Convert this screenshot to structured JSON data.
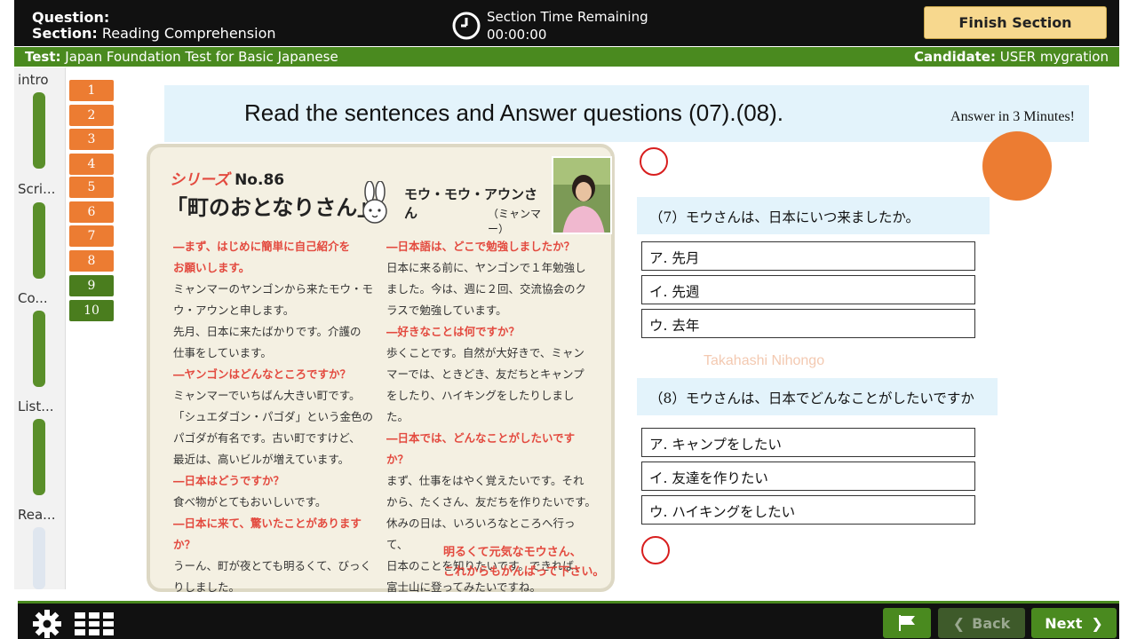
{
  "header": {
    "question_label": "Question:",
    "section_label": "Section:",
    "section_value": "Reading Comprehension",
    "timer_title": "Section Time Remaining",
    "timer_value": "00:00:00",
    "finish_button": "Finish Section"
  },
  "testbar": {
    "test_label": "Test:",
    "test_value": "Japan Foundation Test for Basic Japanese",
    "candidate_label": "Candidate",
    "candidate_value": "USER mygration"
  },
  "sidebar": {
    "items": [
      {
        "label": "intro"
      },
      {
        "label": "Scri..."
      },
      {
        "label": "Co..."
      },
      {
        "label": "List..."
      },
      {
        "label": "Rea..."
      }
    ]
  },
  "question_numbers": [
    "1",
    "2",
    "3",
    "4",
    "5",
    "6",
    "7",
    "8",
    "9",
    "10"
  ],
  "instructions": {
    "text": "Read the sentences and Answer questions (07).(08).",
    "time_note": "Answer in 3 Minutes!"
  },
  "article": {
    "series": "シリーズ",
    "series_no": "No.86",
    "title": "「町のおとなりさん」",
    "name": "モウ・モウ・アウンさん",
    "country": "（ミャンマー）",
    "left_col": [
      {
        "q": "―まず、はじめに簡単に自己紹介を"
      },
      {
        "q": "お願いします。"
      },
      {
        "t": "ミャンマーのヤンゴンから来たモウ・モ"
      },
      {
        "t": "ウ・アウンと申します。"
      },
      {
        "t": "先月、日本に来たばかりです。介護の"
      },
      {
        "t": "仕事をしています。"
      },
      {
        "q": "―ヤンゴンはどんなところですか？"
      },
      {
        "t": "ミャンマーでいちばん大きい町です。"
      },
      {
        "t": "「シュエダゴン・パゴダ」という金色の"
      },
      {
        "t": "パゴダが有名です。古い町ですけど、"
      },
      {
        "t": "最近は、高いビルが増えています。"
      },
      {
        "q": "―日本はどうですか？"
      },
      {
        "t": "食べ物がとてもおいしいです。"
      },
      {
        "q": "―日本に来て、驚いたことがありますか？"
      },
      {
        "t": "うーん、町が夜とても明るくて、びっく"
      },
      {
        "t": "りしました。"
      }
    ],
    "right_col": [
      {
        "q": "―日本語は、どこで勉強しましたか？"
      },
      {
        "t": "日本に来る前に、ヤンゴンで１年勉強し"
      },
      {
        "t": "ました。今は、週に２回、交流協会のク"
      },
      {
        "t": "ラスで勉強しています。"
      },
      {
        "q": "―好きなことは何ですか？"
      },
      {
        "t": "歩くことです。自然が大好きで、ミャン"
      },
      {
        "t": "マーでは、ときどき、友だちとキャンプ"
      },
      {
        "t": "をしたり、ハイキングをしたりしました。"
      },
      {
        "q": "―日本では、どんなことがしたいですか？"
      },
      {
        "t": "まず、仕事をはやく覚えたいです。それ"
      },
      {
        "t": "から、たくさん、友だちを作りたいです。"
      },
      {
        "t": "休みの日は、いろいろなところへ行って、"
      },
      {
        "t": "日本のことを知りたいです。できれば、"
      },
      {
        "t": "富士山に登ってみたいですね。"
      }
    ],
    "closing_1": "明るくて元気なモウさん、",
    "closing_2": "これからもがんばって下さい。"
  },
  "questions": [
    {
      "prompt": "（7）モウさんは、日本にいつ来ましたか。",
      "options": [
        "ア. 先月",
        "イ. 先週",
        "ウ. 去年"
      ]
    },
    {
      "prompt": "（8）モウさんは、日本でどんなことがしたいですか",
      "options": [
        "ア. キャンプをしたい",
        "イ. 友達を作りたい",
        "ウ. ハイキングをしたい"
      ]
    }
  ],
  "watermark": "Takahashi Nihongo",
  "footer": {
    "back_label": "Back",
    "next_label": "Next"
  },
  "colors": {
    "accent_green": "#4a8a1f",
    "question_orange": "#ec7c32",
    "finish_button": "#f7d88e",
    "marker_red": "#d81e1e"
  }
}
